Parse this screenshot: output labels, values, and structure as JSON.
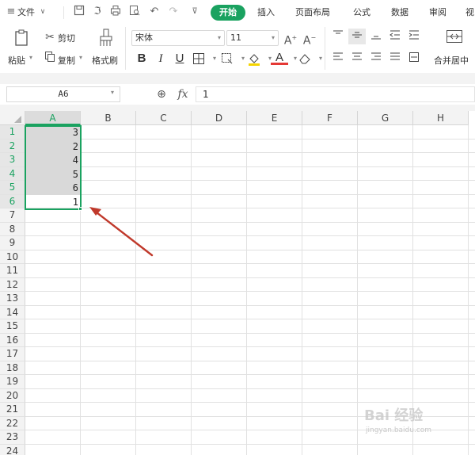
{
  "menubar": {
    "file_label": "文件",
    "tabs": [
      "开始",
      "插入",
      "页面布局",
      "公式",
      "数据",
      "审阅",
      "视"
    ],
    "icons": [
      "menu-icon",
      "save-icon",
      "format-painter-icon",
      "print-icon",
      "print-preview-icon",
      "undo-icon",
      "redo-icon",
      "more-icon"
    ]
  },
  "ribbon": {
    "paste_label": "粘贴",
    "cut_label": "剪切",
    "copy_label": "复制",
    "format_painter_label": "格式刷",
    "font_name": "宋体",
    "font_size": "11",
    "merge_label": "合并居中"
  },
  "formula_bar": {
    "name_box": "A6",
    "fx": "fx",
    "value": "1"
  },
  "grid": {
    "columns": [
      "A",
      "B",
      "C",
      "D",
      "E",
      "F",
      "G",
      "H"
    ],
    "rows": [
      "1",
      "2",
      "3",
      "4",
      "5",
      "6",
      "7",
      "8",
      "9",
      "10",
      "11",
      "12",
      "13",
      "14",
      "15",
      "16",
      "17",
      "18",
      "19",
      "20",
      "21",
      "22",
      "23",
      "24"
    ],
    "column_a_values": [
      "3",
      "2",
      "4",
      "5",
      "6",
      "1"
    ],
    "selected_range": "A1:A6",
    "active_cell": "A6"
  },
  "colors": {
    "accent": "#1aa260",
    "selection_fill": "#d9d9d9",
    "annotation_arrow": "#c0392b"
  },
  "watermark": {
    "text": "Bai 经验",
    "sub": "jingyan.baidu.com"
  }
}
